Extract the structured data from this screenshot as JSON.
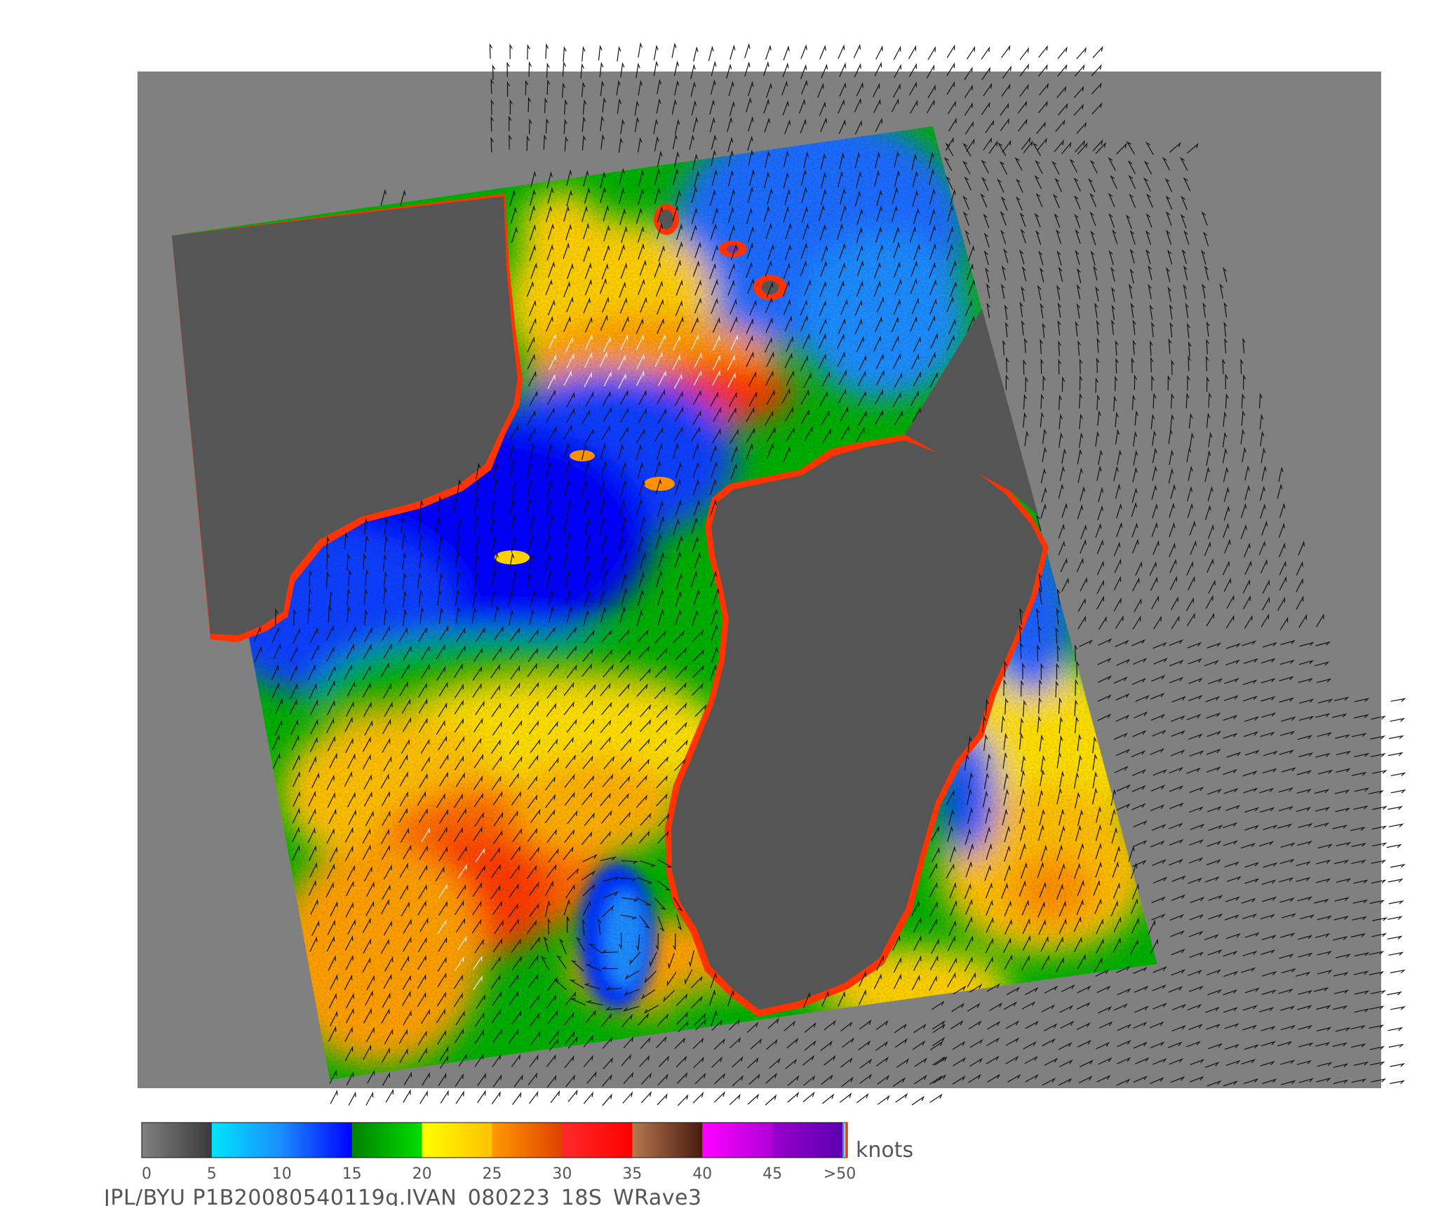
{
  "map": {
    "background_color": "#808080",
    "land_color": "#555555",
    "vector_color": "#111111",
    "rain_vector_color": "#f2f2f2"
  },
  "colorbar": {
    "units": "knots",
    "ticks": [
      "0",
      "5",
      "10",
      "15",
      "20",
      "25",
      "30",
      "35",
      "40",
      "45",
      ">50"
    ],
    "bands": [
      {
        "from": 0,
        "to": 5,
        "colors": [
          "#808080",
          "#3a3a3a"
        ]
      },
      {
        "from": 5,
        "to": 10,
        "colors": [
          "#00e5ff",
          "#1a8cff"
        ]
      },
      {
        "from": 10,
        "to": 15,
        "colors": [
          "#1a8cff",
          "#0000ff"
        ]
      },
      {
        "from": 15,
        "to": 20,
        "colors": [
          "#008000",
          "#00e000"
        ]
      },
      {
        "from": 20,
        "to": 25,
        "colors": [
          "#ffff00",
          "#ffc000"
        ]
      },
      {
        "from": 25,
        "to": 30,
        "colors": [
          "#ff9900",
          "#e04000"
        ]
      },
      {
        "from": 30,
        "to": 35,
        "colors": [
          "#ff2a2a",
          "#ff0000"
        ]
      },
      {
        "from": 35,
        "to": 40,
        "colors": [
          "#b57850",
          "#4a1a10"
        ]
      },
      {
        "from": 40,
        "to": 45,
        "colors": [
          "#ff00ff",
          "#b000d8"
        ]
      },
      {
        "from": 45,
        "to": 50,
        "colors": [
          "#9a00cc",
          "#5a00b0"
        ]
      }
    ]
  },
  "footer": {
    "caption": "JPL/BYU  P1B20080540119q.IVAN_080223_18S_WRave3"
  }
}
